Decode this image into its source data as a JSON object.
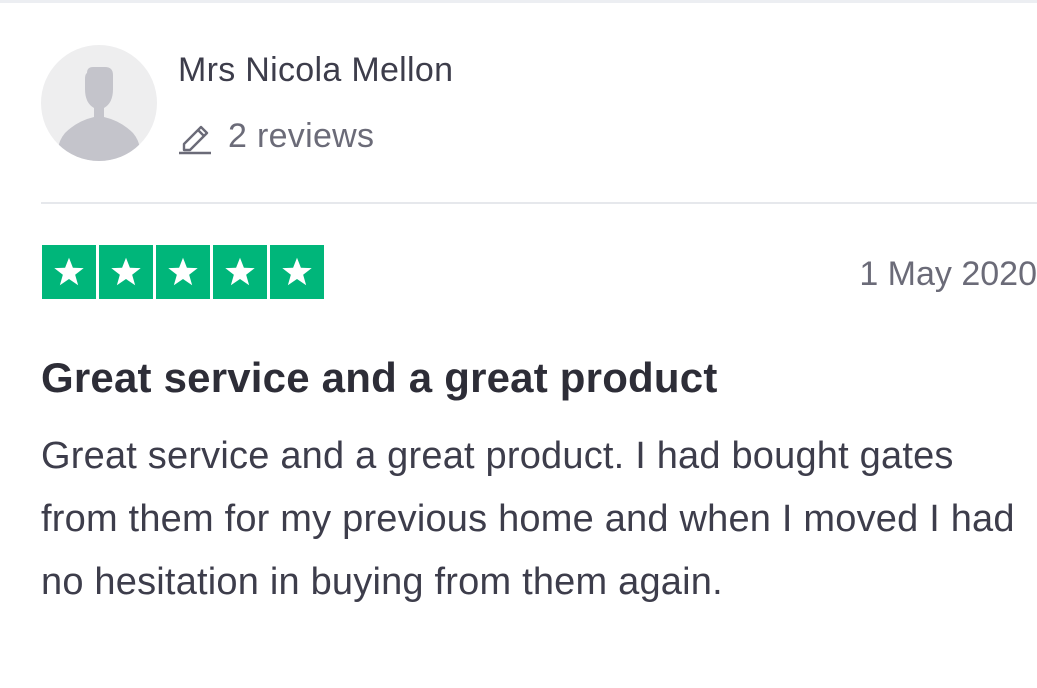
{
  "reviewer": {
    "name": "Mrs Nicola Mellon",
    "review_count": "2 reviews",
    "avatar_icon": "default-user-avatar",
    "count_icon": "pencil-icon"
  },
  "review": {
    "rating": 5,
    "max_rating": 5,
    "star_color": "#00b67a",
    "date": "1 May 2020",
    "title": "Great service and a great product",
    "body": "Great service and a great product. I had bought gates from them for my previous home and when I moved I had no hesitation in buying from them again."
  }
}
